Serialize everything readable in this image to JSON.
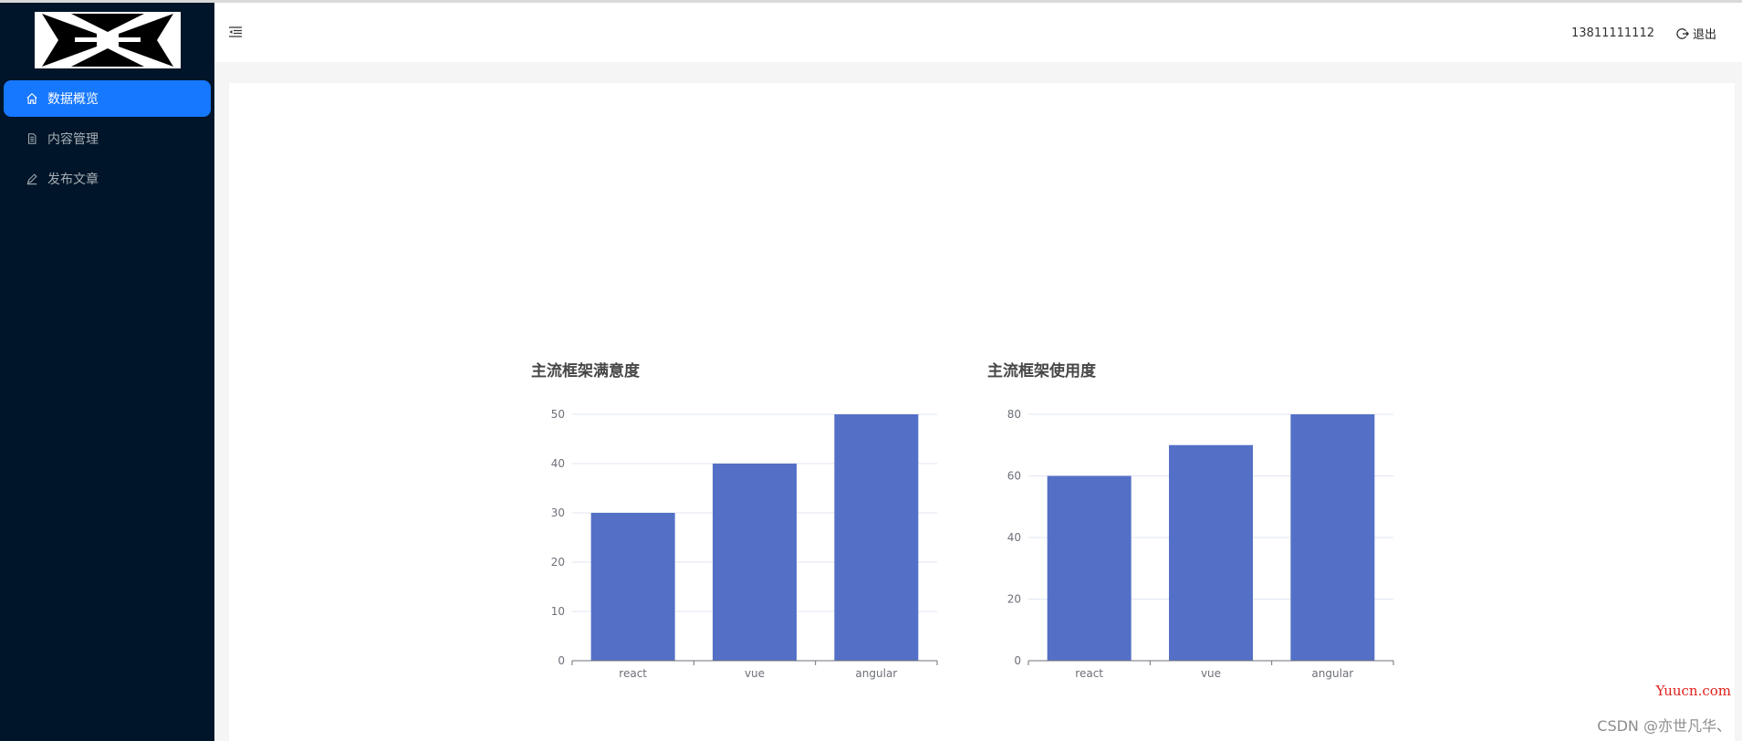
{
  "sidebar": {
    "items": [
      {
        "label": "数据概览",
        "icon": "home-icon",
        "active": true
      },
      {
        "label": "内容管理",
        "icon": "file-icon",
        "active": false
      },
      {
        "label": "发布文章",
        "icon": "edit-icon",
        "active": false
      }
    ]
  },
  "header": {
    "phone": "13811111112",
    "logout_label": "退出"
  },
  "colors": {
    "sidebar_bg": "#001529",
    "active_bg": "#1677ff",
    "bar": "#5470c6"
  },
  "chart_data": [
    {
      "type": "bar",
      "title": "主流框架满意度",
      "categories": [
        "react",
        "vue",
        "angular"
      ],
      "values": [
        30,
        40,
        50
      ],
      "ylim": [
        0,
        50
      ],
      "yticks": [
        0,
        10,
        20,
        30,
        40,
        50
      ],
      "grid": true
    },
    {
      "type": "bar",
      "title": "主流框架使用度",
      "categories": [
        "react",
        "vue",
        "angular"
      ],
      "values": [
        60,
        70,
        80
      ],
      "ylim": [
        0,
        80
      ],
      "yticks": [
        0,
        20,
        40,
        60,
        80
      ],
      "grid": true
    }
  ],
  "watermarks": {
    "site": "Yuucn.com",
    "csdn": "CSDN @亦世凡华、"
  }
}
